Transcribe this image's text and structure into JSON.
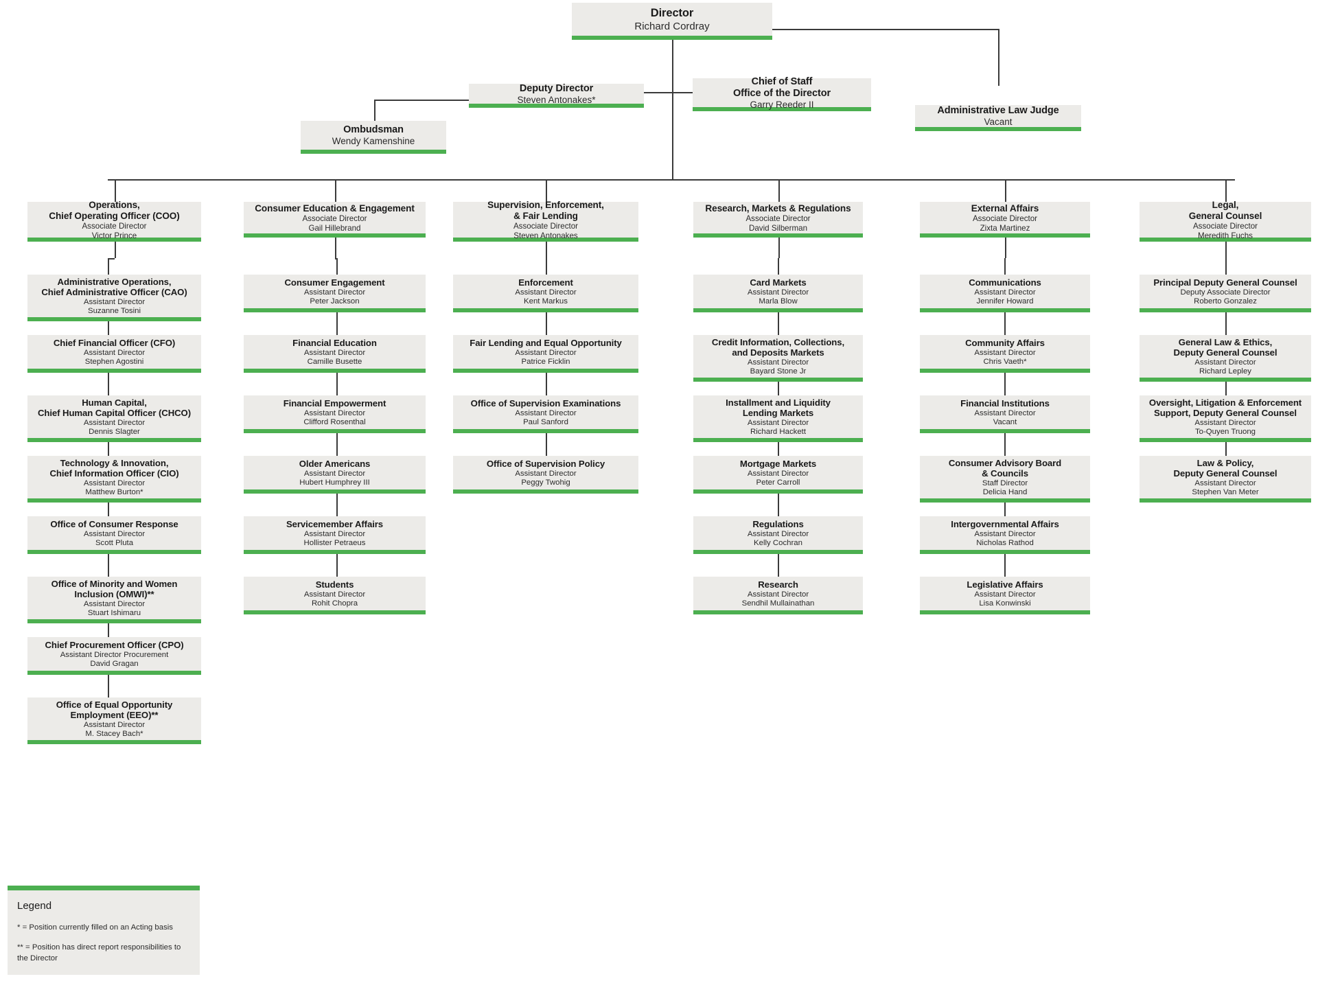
{
  "colors": {
    "accent": "#4caf50",
    "box_fill": "#ecebe8",
    "line": "#3a3a3a",
    "text": "#1a1a1a",
    "background": "#ffffff"
  },
  "role_labels": {
    "associate_director": "Associate Director",
    "assistant_director": "Assistant Director"
  },
  "top": {
    "director": {
      "title": "Director",
      "person": "Richard Cordray"
    },
    "deputy_director": {
      "title": "Deputy Director",
      "person": "Steven Antonakes*"
    },
    "chief_of_staff": {
      "title_line1": "Chief of Staff",
      "title_line2": "Office of the Director",
      "person": "Garry Reeder II"
    },
    "administrative_law_judge": {
      "title": "Administrative Law Judge",
      "person": "Vacant"
    },
    "ombudsman": {
      "title": "Ombudsman",
      "person": "Wendy Kamenshine"
    }
  },
  "divisions": [
    {
      "id": "operations",
      "title_line1": "Operations,",
      "title_line2": "Chief Operating Officer (COO)",
      "role": "Associate Director",
      "person": "Victor Prince",
      "units": [
        {
          "title_line1": "Administrative Operations,",
          "title_line2": "Chief Administrative Officer (CAO)",
          "role": "Assistant Director",
          "person": "Suzanne Tosini"
        },
        {
          "title_line1": "Chief Financial Officer (CFO)",
          "title_line2": "",
          "role": "Assistant Director",
          "person": "Stephen Agostini"
        },
        {
          "title_line1": "Human Capital,",
          "title_line2": "Chief Human Capital Officer (CHCO)",
          "role": "Assistant Director",
          "person": "Dennis Slagter"
        },
        {
          "title_line1": "Technology & Innovation,",
          "title_line2": "Chief Information Officer (CIO)",
          "role": "Assistant Director",
          "person": "Matthew Burton*"
        },
        {
          "title_line1": "Office of Consumer Response",
          "title_line2": "",
          "role": "Assistant Director",
          "person": "Scott Pluta"
        },
        {
          "title_line1": "Office of Minority and Women",
          "title_line2": "Inclusion (OMWI)**",
          "role": "Assistant Director",
          "person": "Stuart Ishimaru"
        },
        {
          "title_line1": "Chief Procurement Officer (CPO)",
          "title_line2": "",
          "role": "Assistant Director Procurement",
          "person": "David Gragan"
        },
        {
          "title_line1": "Office of Equal Opportunity",
          "title_line2": "Employment (EEO)**",
          "role": "Assistant Director",
          "person": "M. Stacey Bach*"
        }
      ]
    },
    {
      "id": "consumer-education-engagement",
      "title_line1": "Consumer Education & Engagement",
      "title_line2": "",
      "role": "Associate Director",
      "person": "Gail Hillebrand",
      "units": [
        {
          "title_line1": "Consumer Engagement",
          "title_line2": "",
          "role": "Assistant Director",
          "person": "Peter Jackson"
        },
        {
          "title_line1": "Financial Education",
          "title_line2": "",
          "role": "Assistant Director",
          "person": "Camille Busette"
        },
        {
          "title_line1": "Financial Empowerment",
          "title_line2": "",
          "role": "Assistant Director",
          "person": "Clifford Rosenthal"
        },
        {
          "title_line1": "Older Americans",
          "title_line2": "",
          "role": "Assistant Director",
          "person": "Hubert Humphrey III"
        },
        {
          "title_line1": "Servicemember Affairs",
          "title_line2": "",
          "role": "Assistant Director",
          "person": "Hollister Petraeus"
        },
        {
          "title_line1": "Students",
          "title_line2": "",
          "role": "Assistant Director",
          "person": "Rohit Chopra"
        }
      ]
    },
    {
      "id": "supervision-enforcement-fair-lending",
      "title_line1": "Supervision, Enforcement,",
      "title_line2": "& Fair Lending",
      "role": "Associate Director",
      "person": "Steven Antonakes",
      "units": [
        {
          "title_line1": "Enforcement",
          "title_line2": "",
          "role": "Assistant Director",
          "person": "Kent Markus"
        },
        {
          "title_line1": "Fair Lending and Equal Opportunity",
          "title_line2": "",
          "role": "Assistant Director",
          "person": "Patrice Ficklin"
        },
        {
          "title_line1": "Office of Supervision Examinations",
          "title_line2": "",
          "role": "Assistant Director",
          "person": "Paul Sanford"
        },
        {
          "title_line1": "Office of Supervision Policy",
          "title_line2": "",
          "role": "Assistant Director",
          "person": "Peggy Twohig"
        }
      ]
    },
    {
      "id": "research-markets-regulations",
      "title_line1": "Research, Markets & Regulations",
      "title_line2": "",
      "role": "Associate Director",
      "person": "David Silberman",
      "units": [
        {
          "title_line1": "Card Markets",
          "title_line2": "",
          "role": "Assistant Director",
          "person": "Marla Blow"
        },
        {
          "title_line1": "Credit Information, Collections,",
          "title_line2": "and Deposits Markets",
          "role": "Assistant Director",
          "person": "Bayard Stone Jr"
        },
        {
          "title_line1": "Installment and Liquidity",
          "title_line2": "Lending Markets",
          "role": "Assistant Director",
          "person": "Richard Hackett"
        },
        {
          "title_line1": "Mortgage Markets",
          "title_line2": "",
          "role": "Assistant Director",
          "person": "Peter Carroll"
        },
        {
          "title_line1": "Regulations",
          "title_line2": "",
          "role": "Assistant Director",
          "person": "Kelly Cochran"
        },
        {
          "title_line1": "Research",
          "title_line2": "",
          "role": "Assistant Director",
          "person": "Sendhil Mullainathan"
        }
      ]
    },
    {
      "id": "external-affairs",
      "title_line1": "External Affairs",
      "title_line2": "",
      "role": "Associate Director",
      "person": "Zixta Martinez",
      "units": [
        {
          "title_line1": "Communications",
          "title_line2": "",
          "role": "Assistant Director",
          "person": "Jennifer Howard"
        },
        {
          "title_line1": "Community Affairs",
          "title_line2": "",
          "role": "Assistant Director",
          "person": "Chris Vaeth*"
        },
        {
          "title_line1": "Financial Institutions",
          "title_line2": "",
          "role": "Assistant Director",
          "person": "Vacant"
        },
        {
          "title_line1": "Consumer Advisory Board",
          "title_line2": "& Councils",
          "role": "Staff Director",
          "person": "Delicia Hand"
        },
        {
          "title_line1": "Intergovernmental Affairs",
          "title_line2": "",
          "role": "Assistant Director",
          "person": "Nicholas Rathod"
        },
        {
          "title_line1": "Legislative Affairs",
          "title_line2": "",
          "role": "Assistant Director",
          "person": "Lisa Konwinski"
        }
      ]
    },
    {
      "id": "legal-general-counsel",
      "title_line1": "Legal,",
      "title_line2": "General Counsel",
      "role": "Associate Director",
      "person": "Meredith Fuchs",
      "units": [
        {
          "title_line1": "Principal Deputy General Counsel",
          "title_line2": "",
          "role": "Deputy Associate Director",
          "person": "Roberto Gonzalez"
        },
        {
          "title_line1": "General Law & Ethics,",
          "title_line2": "Deputy General Counsel",
          "role": "Assistant Director",
          "person": "Richard Lepley"
        },
        {
          "title_line1": "Oversight, Litigation & Enforcement",
          "title_line2": "Support, Deputy General Counsel",
          "role": "Assistant Director",
          "person": "To-Quyen Truong"
        },
        {
          "title_line1": "Law & Policy,",
          "title_line2": "Deputy General Counsel",
          "role": "Assistant Director",
          "person": "Stephen Van Meter"
        }
      ]
    }
  ],
  "legend": {
    "heading": "Legend",
    "note_acting": "* = Position currently filled on an Acting basis",
    "note_direct_report": "** = Position has direct report responsibilities to the Director"
  }
}
